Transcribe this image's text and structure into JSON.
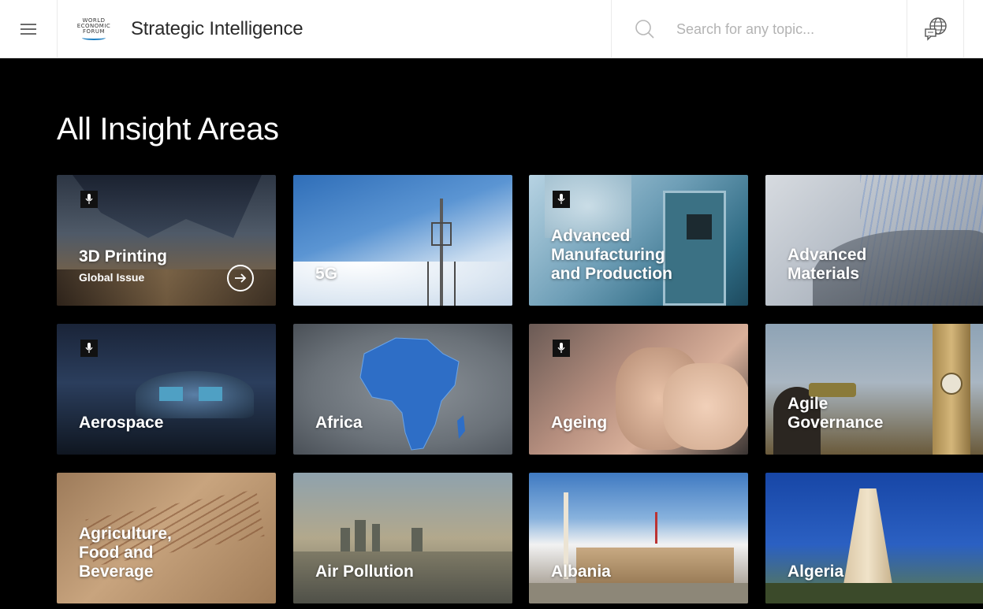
{
  "header": {
    "logo_lines": [
      "WORLD",
      "ECONOMIC",
      "FORUM"
    ],
    "title": "Strategic Intelligence",
    "search_placeholder": "Search for any topic...",
    "icons": {
      "menu": "hamburger-menu-icon",
      "search": "search-icon",
      "language": "language-globe-icon"
    }
  },
  "main": {
    "heading": "All Insight Areas",
    "cards": [
      {
        "label": "3D Printing",
        "sub": "Global Issue",
        "has_mic": true,
        "has_arrow": true
      },
      {
        "label": "5G",
        "has_mic": false
      },
      {
        "label": "Advanced\nManufacturing\nand Production",
        "has_mic": true
      },
      {
        "label": "Advanced\nMaterials",
        "has_mic": false
      },
      {
        "label": "Aerospace",
        "has_mic": true
      },
      {
        "label": "Africa",
        "has_mic": false
      },
      {
        "label": "Ageing",
        "has_mic": true
      },
      {
        "label": "Agile\nGovernance",
        "has_mic": false
      },
      {
        "label": "Agriculture,\nFood and\nBeverage",
        "has_mic": false
      },
      {
        "label": "Air Pollution",
        "has_mic": false
      },
      {
        "label": "Albania",
        "has_mic": false
      },
      {
        "label": "Algeria",
        "has_mic": false
      }
    ]
  },
  "colors": {
    "background": "#000000",
    "header_bg": "#ffffff",
    "brand_blue": "#1e7fc2"
  }
}
